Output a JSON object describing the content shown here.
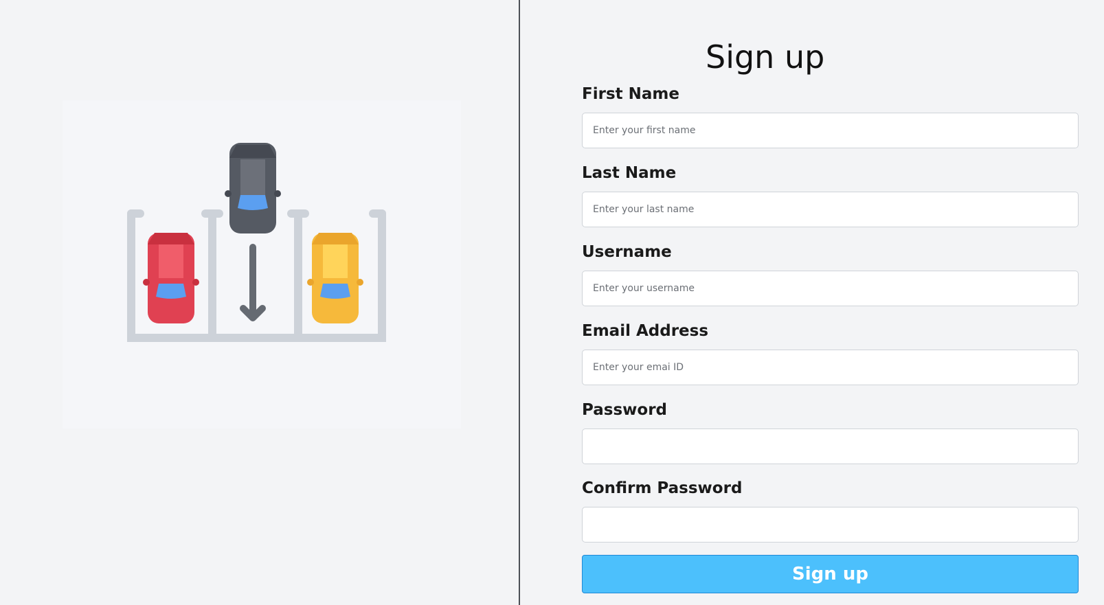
{
  "page": {
    "title": "Sign up"
  },
  "illustration": {
    "icon": "parking-lot-cars-illustration",
    "colors": {
      "lot_lines": "#cdd2d9",
      "car_left": "#e04152",
      "car_center": "#555a63",
      "car_right": "#f6b93b",
      "windshield": "#5b9ff0"
    }
  },
  "form": {
    "fields": [
      {
        "label": "First Name",
        "placeholder": "Enter your first name",
        "value": "",
        "type": "text"
      },
      {
        "label": "Last Name",
        "placeholder": "Enter your last name",
        "value": "",
        "type": "text"
      },
      {
        "label": "Username",
        "placeholder": "Enter your username",
        "value": "",
        "type": "text"
      },
      {
        "label": "Email Address",
        "placeholder": "Enter your emai ID",
        "value": "",
        "type": "email"
      },
      {
        "label": "Password",
        "placeholder": "",
        "value": "",
        "type": "password"
      },
      {
        "label": "Confirm Password",
        "placeholder": "",
        "value": "",
        "type": "password"
      }
    ],
    "submit_label": "Sign up"
  },
  "colors": {
    "background": "#f3f4f6",
    "button": "#4cc0fc",
    "divider": "#4b4f56"
  }
}
